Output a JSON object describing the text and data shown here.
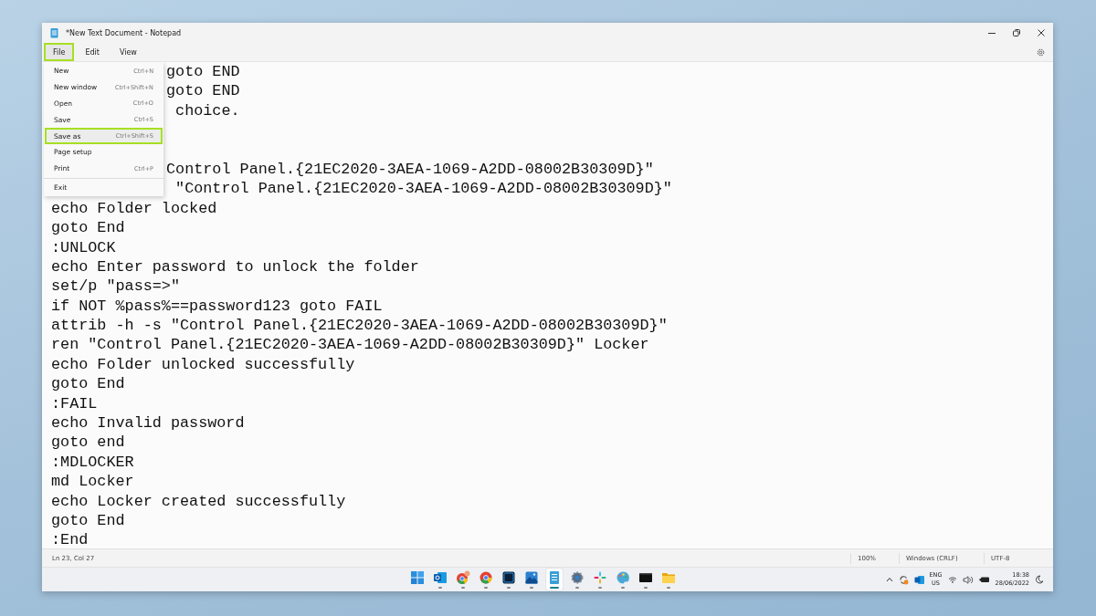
{
  "window": {
    "title": "*New Text Document - Notepad"
  },
  "menu_bar": [
    {
      "label": "File",
      "selected": true,
      "highlighted": true
    },
    {
      "label": "Edit",
      "selected": false,
      "highlighted": false
    },
    {
      "label": "View",
      "selected": false,
      "highlighted": false
    }
  ],
  "file_menu": [
    {
      "kind": "item",
      "label": "New",
      "shortcut": "Ctrl+N",
      "highlighted": false
    },
    {
      "kind": "item",
      "label": "New window",
      "shortcut": "Ctrl+Shift+N",
      "highlighted": false
    },
    {
      "kind": "item",
      "label": "Open",
      "shortcut": "Ctrl+O",
      "highlighted": false
    },
    {
      "kind": "item",
      "label": "Save",
      "shortcut": "Ctrl+S",
      "highlighted": false
    },
    {
      "kind": "item",
      "label": "Save as",
      "shortcut": "Ctrl+Shift+S",
      "highlighted": true
    },
    {
      "kind": "item",
      "label": "Page setup",
      "highlighted": false
    },
    {
      "kind": "item",
      "label": "Print",
      "shortcut": "Ctrl+P",
      "highlighted": false
    },
    {
      "kind": "separator"
    },
    {
      "kind": "item",
      "label": "Exit",
      "highlighted": false
    }
  ],
  "editor_lines": [
    {
      "kind": "covered",
      "text": "goto END"
    },
    {
      "kind": "covered",
      "text": "goto END"
    },
    {
      "kind": "covered",
      "text": " choice."
    },
    {
      "kind": "blank"
    },
    {
      "kind": "blank"
    },
    {
      "kind": "covered",
      "text": "Control Panel.{21EC2020-3AEA-1069-A2DD-08002B30309D}\""
    },
    {
      "kind": "covered",
      "text": " \"Control Panel.{21EC2020-3AEA-1069-A2DD-08002B30309D}\""
    },
    {
      "kind": "text",
      "text": "echo Folder locked"
    },
    {
      "kind": "text",
      "text": "goto End"
    },
    {
      "kind": "text",
      "text": ":UNLOCK"
    },
    {
      "kind": "text",
      "text": "echo Enter password to unlock the folder"
    },
    {
      "kind": "text",
      "text": "set/p \"pass=>\""
    },
    {
      "kind": "text",
      "text": "if NOT %pass%==password123 goto FAIL"
    },
    {
      "kind": "text",
      "text": "attrib -h -s \"Control Panel.{21EC2020-3AEA-1069-A2DD-08002B30309D}\""
    },
    {
      "kind": "text",
      "text": "ren \"Control Panel.{21EC2020-3AEA-1069-A2DD-08002B30309D}\" Locker"
    },
    {
      "kind": "text",
      "text": "echo Folder unlocked successfully"
    },
    {
      "kind": "text",
      "text": "goto End"
    },
    {
      "kind": "text",
      "text": ":FAIL"
    },
    {
      "kind": "text",
      "text": "echo Invalid password"
    },
    {
      "kind": "text",
      "text": "goto end"
    },
    {
      "kind": "text",
      "text": ":MDLOCKER"
    },
    {
      "kind": "text",
      "text": "md Locker"
    },
    {
      "kind": "text",
      "text": "echo Locker created successfully"
    },
    {
      "kind": "text",
      "text": "goto End"
    },
    {
      "kind": "text",
      "text": ":End"
    }
  ],
  "status_bar": {
    "position": "Ln 23, Col 27",
    "zoom": "100%",
    "line_ending": "Windows (CRLF)",
    "encoding": "UTF-8"
  },
  "taskbar": {
    "apps": [
      {
        "kind": "start",
        "running": false,
        "active": false
      },
      {
        "kind": "mail",
        "running": true,
        "active": false
      },
      {
        "kind": "browser-badge",
        "running": true,
        "active": false
      },
      {
        "kind": "browser",
        "running": true,
        "active": false
      },
      {
        "kind": "dark-tile",
        "running": true,
        "active": false
      },
      {
        "kind": "photos",
        "running": true,
        "active": false
      },
      {
        "kind": "notepad",
        "running": true,
        "active": true
      },
      {
        "kind": "gear",
        "running": true,
        "active": false
      },
      {
        "kind": "pinwheel",
        "running": true,
        "active": false
      },
      {
        "kind": "palette",
        "running": true,
        "active": false
      },
      {
        "kind": "terminal",
        "running": true,
        "active": false
      },
      {
        "kind": "folder",
        "running": true,
        "active": false
      }
    ],
    "language": [
      "ENG",
      "US"
    ],
    "time": "18:38",
    "date": "28/06/2022"
  }
}
